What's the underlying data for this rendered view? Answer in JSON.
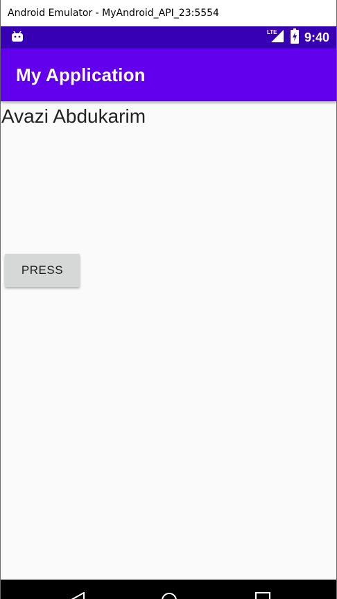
{
  "window": {
    "title": "Android Emulator - MyAndroid_API_23:5554"
  },
  "status_bar": {
    "notification_icon": "android-icon",
    "network_label": "LTE",
    "signal_icon": "signal-icon",
    "battery_icon": "battery-charging-icon",
    "time": "9:40"
  },
  "app_bar": {
    "title": "My Application"
  },
  "content": {
    "name_text": "Avazi Abdukarim",
    "button_label": "PRESS"
  },
  "nav_bar": {
    "buttons": [
      "back-icon",
      "home-icon",
      "recents-icon"
    ]
  },
  "colors": {
    "status_bar": "#3700b3",
    "app_bar": "#6200ee",
    "background": "#fafafa",
    "button": "#d6d7d7"
  }
}
